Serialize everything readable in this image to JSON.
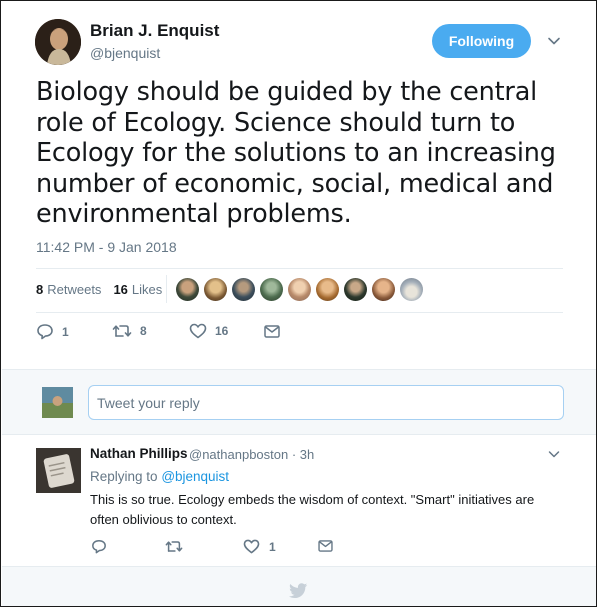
{
  "tweet": {
    "author_name": "Brian J. Enquist",
    "author_handle": "@bjenquist",
    "follow_label": "Following",
    "text": "Biology should be guided by the central role of Ecology. Science should turn to Ecology for the solutions to an increasing number of economic, social, medical and environmental problems.",
    "timestamp": "11:42 PM - 9 Jan 2018",
    "stats": {
      "retweets_count": "8",
      "retweets_label": "Retweets",
      "likes_count": "16",
      "likes_label": "Likes"
    },
    "likers_count": 9,
    "actions": {
      "reply_count": "1",
      "retweet_count": "8",
      "like_count": "16"
    }
  },
  "reply_compose": {
    "placeholder": "Tweet your reply"
  },
  "reply": {
    "author_name": "Nathan Phillips",
    "author_handle": "@nathanpboston · 3h",
    "replying_prefix": "Replying to",
    "replying_to": "@bjenquist",
    "text": "This is so true. Ecology embeds the wisdom of context. \"Smart\" initiatives are often oblivious to context.",
    "actions": {
      "reply_count": "",
      "retweet_count": "",
      "like_count": "1"
    }
  },
  "colors": {
    "accent": "#1b95e0",
    "follow_button": "#4aabf0",
    "muted_text": "#657786",
    "text": "#14171a",
    "divider": "#e6ecf0",
    "background_alt": "#f5f8fa"
  },
  "icons": {
    "reply": "reply-icon",
    "retweet": "retweet-icon",
    "like": "heart-icon",
    "message": "envelope-icon",
    "caret": "chevron-down-icon",
    "footer": "twitter-bird-icon"
  }
}
